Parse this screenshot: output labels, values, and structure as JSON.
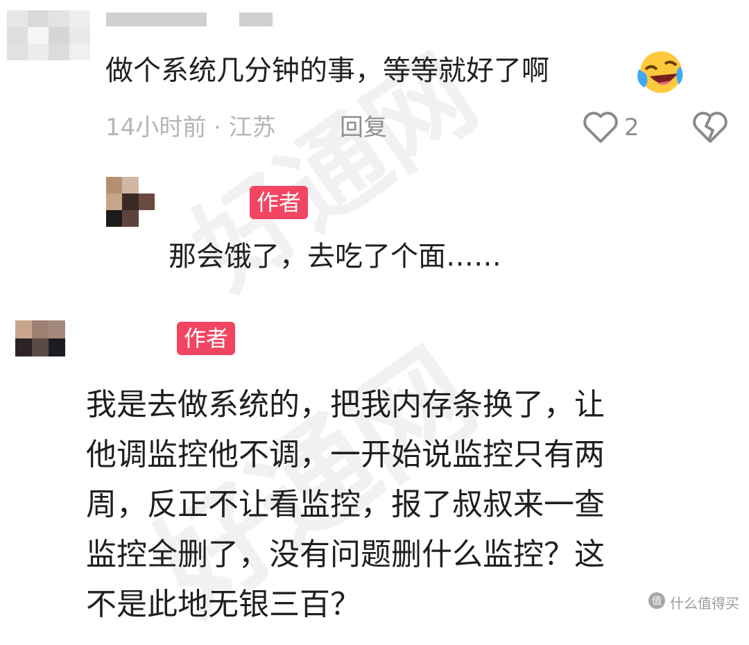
{
  "watermark": {
    "text": "好通网"
  },
  "comments": [
    {
      "avatar": "pixelated-avatar",
      "text": "做个系统几分钟的事，等等就好了啊",
      "emoji": "laughing-crying-face-icon",
      "meta": "14小时前 · 江苏",
      "reply_label": "回复",
      "likes": "2"
    },
    {
      "avatar": "pixelated-avatar",
      "badge": "作者",
      "text": "那会饿了，去吃了个面……"
    },
    {
      "avatar": "pixelated-avatar",
      "badge": "作者",
      "lines": [
        "我是去做系统的，把我内存条换了，让",
        "他调监控他不调，一开始说监控只有两",
        "周，反正不让看监控，报了叔叔来一查",
        "监控全删了，没有问题删什么监控？这",
        "不是此地无银三百？"
      ]
    }
  ],
  "brand": {
    "icon": "smzdm-logo-icon",
    "text": "什么值得买"
  },
  "colors": {
    "badge": "#f24562",
    "meta": "#b5b5b5",
    "text": "#1f1f1f"
  }
}
